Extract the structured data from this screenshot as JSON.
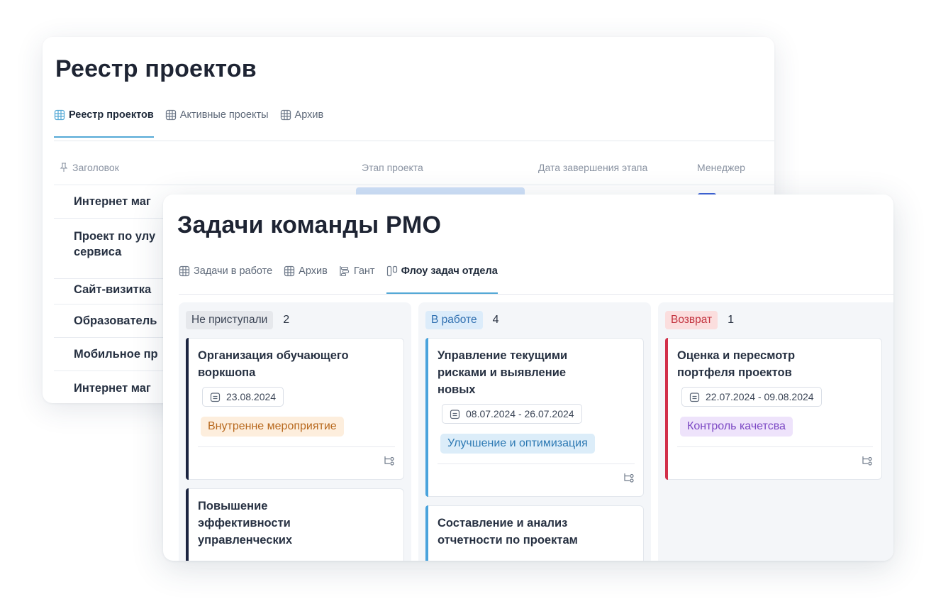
{
  "registry": {
    "title": "Реестр проектов",
    "tabs": [
      {
        "label": "Реестр проектов",
        "icon": "table-icon",
        "active": true
      },
      {
        "label": "Активные проекты",
        "icon": "table-icon",
        "active": false
      },
      {
        "label": "Архив",
        "icon": "table-icon",
        "active": false
      }
    ],
    "columns": {
      "title": "Заголовок",
      "stage": "Этап проекта",
      "stage_end": "Дата завершения этапа",
      "manager": "Менеджер"
    },
    "rows": [
      "Интернет маг",
      "Проект по улу\nсервиса",
      "Сайт-визитка",
      "Образователь",
      "Мобильное пр",
      "Интернет маг"
    ]
  },
  "tasks": {
    "title": "Задачи команды PMO",
    "tabs": [
      {
        "label": "Задачи в работе",
        "icon": "table-icon",
        "active": false
      },
      {
        "label": "Архив",
        "icon": "table-icon",
        "active": false
      },
      {
        "label": "Гант",
        "icon": "gantt-icon",
        "active": false
      },
      {
        "label": "Флоу задач отдела",
        "icon": "kanban-icon",
        "active": true
      }
    ],
    "board": [
      {
        "status": "Не приступали",
        "count": "2",
        "pill_bg": "#e6e8ec",
        "pill_color": "#3a4354",
        "accent": "#1b2440",
        "cards": [
          {
            "title": "Организация обучающего воркшопа",
            "date": "23.08.2024",
            "tag": "Внутренне мероприятие",
            "tag_bg": "#fdeedd",
            "tag_color": "#b8691e"
          },
          {
            "title": "Повышение эффективности управленческих",
            "date": "",
            "tag": ""
          }
        ]
      },
      {
        "status": "В работе",
        "count": "4",
        "pill_bg": "#dcecfa",
        "pill_color": "#2f6fb0",
        "accent": "#4aa3dc",
        "cards": [
          {
            "title": "Управление текущими рисками и выявление новых",
            "date": "08.07.2024 - 26.07.2024",
            "tag": "Улучшение и оптимизация",
            "tag_bg": "#dcedf9",
            "tag_color": "#2d79b3"
          },
          {
            "title": "Составление и анализ отчетности по проектам",
            "date": "",
            "tag": ""
          }
        ]
      },
      {
        "status": "Возврат",
        "count": "1",
        "pill_bg": "#fbdede",
        "pill_color": "#c2323e",
        "accent": "#d2304a",
        "cards": [
          {
            "title": "Оценка и пересмотр портфеля проектов",
            "date": "22.07.2024 - 09.08.2024",
            "tag": "Контроль качетсва",
            "tag_bg": "#eee3fb",
            "tag_color": "#7c48c4"
          }
        ]
      }
    ]
  }
}
